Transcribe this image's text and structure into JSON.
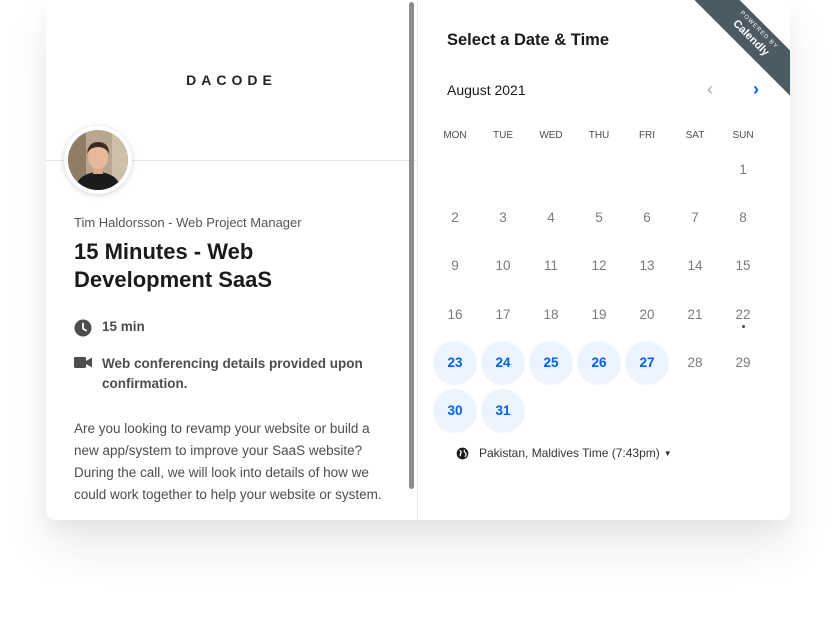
{
  "brand": "DACODE",
  "host": "Tim Haldorsson - Web Project Manager",
  "event_title": "15 Minutes - Web Development SaaS",
  "duration": "15 min",
  "conferencing": "Web conferencing details provided upon confirmation.",
  "description": "Are you looking to revamp your website or build a new app/system to improve your SaaS website? During the call, we will look into details of how we could work together to help your website or system.",
  "calendar": {
    "heading": "Select a Date & Time",
    "month": "August 2021",
    "prev": "‹",
    "next": "›",
    "weekdays": [
      "MON",
      "TUE",
      "WED",
      "THU",
      "FRI",
      "SAT",
      "SUN"
    ],
    "days": [
      "1",
      "2",
      "3",
      "4",
      "5",
      "6",
      "7",
      "8",
      "9",
      "10",
      "11",
      "12",
      "13",
      "14",
      "15",
      "16",
      "17",
      "18",
      "19",
      "20",
      "21",
      "22",
      "23",
      "24",
      "25",
      "26",
      "27",
      "28",
      "29",
      "30",
      "31"
    ],
    "available": [
      "23",
      "24",
      "25",
      "26",
      "27",
      "30",
      "31"
    ],
    "today": "22",
    "first_weekday_index": 6
  },
  "timezone": "Pakistan, Maldives Time (7:43pm)",
  "badge": {
    "powered": "POWERED BY",
    "name": "Calendly"
  },
  "colors": {
    "accent": "#0069ff",
    "available_bg": "#edf4ff",
    "ribbon": "#4b5a63"
  },
  "icons": {
    "duration": "clock-icon",
    "conferencing": "video-camera-icon",
    "timezone": "globe-icon"
  }
}
